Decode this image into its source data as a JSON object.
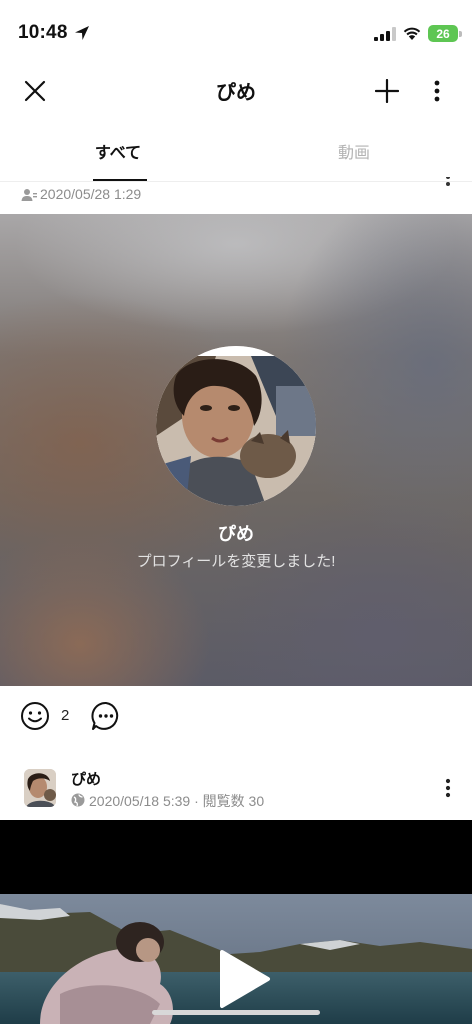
{
  "status_bar": {
    "time": "10:48",
    "battery": "26"
  },
  "header": {
    "title": "ぴめ",
    "icons": [
      "close-icon",
      "plus-icon",
      "more-vertical-icon"
    ]
  },
  "tabs": [
    {
      "label": "すべて",
      "selected": true
    },
    {
      "label": "動画",
      "selected": false
    }
  ],
  "post1": {
    "date": "2020/05/28 1:29",
    "profile_name": "ぴめ",
    "message": "プロフィールを変更しました!",
    "reaction_count": "2"
  },
  "post2": {
    "name": "ぴめ",
    "meta": "2020/05/18 5:39 · 閲覧数 30"
  },
  "colors": {
    "battery": "#5ec653",
    "tab_inactive": "#b3b3b3",
    "meta_gray": "#8c8c8c"
  }
}
